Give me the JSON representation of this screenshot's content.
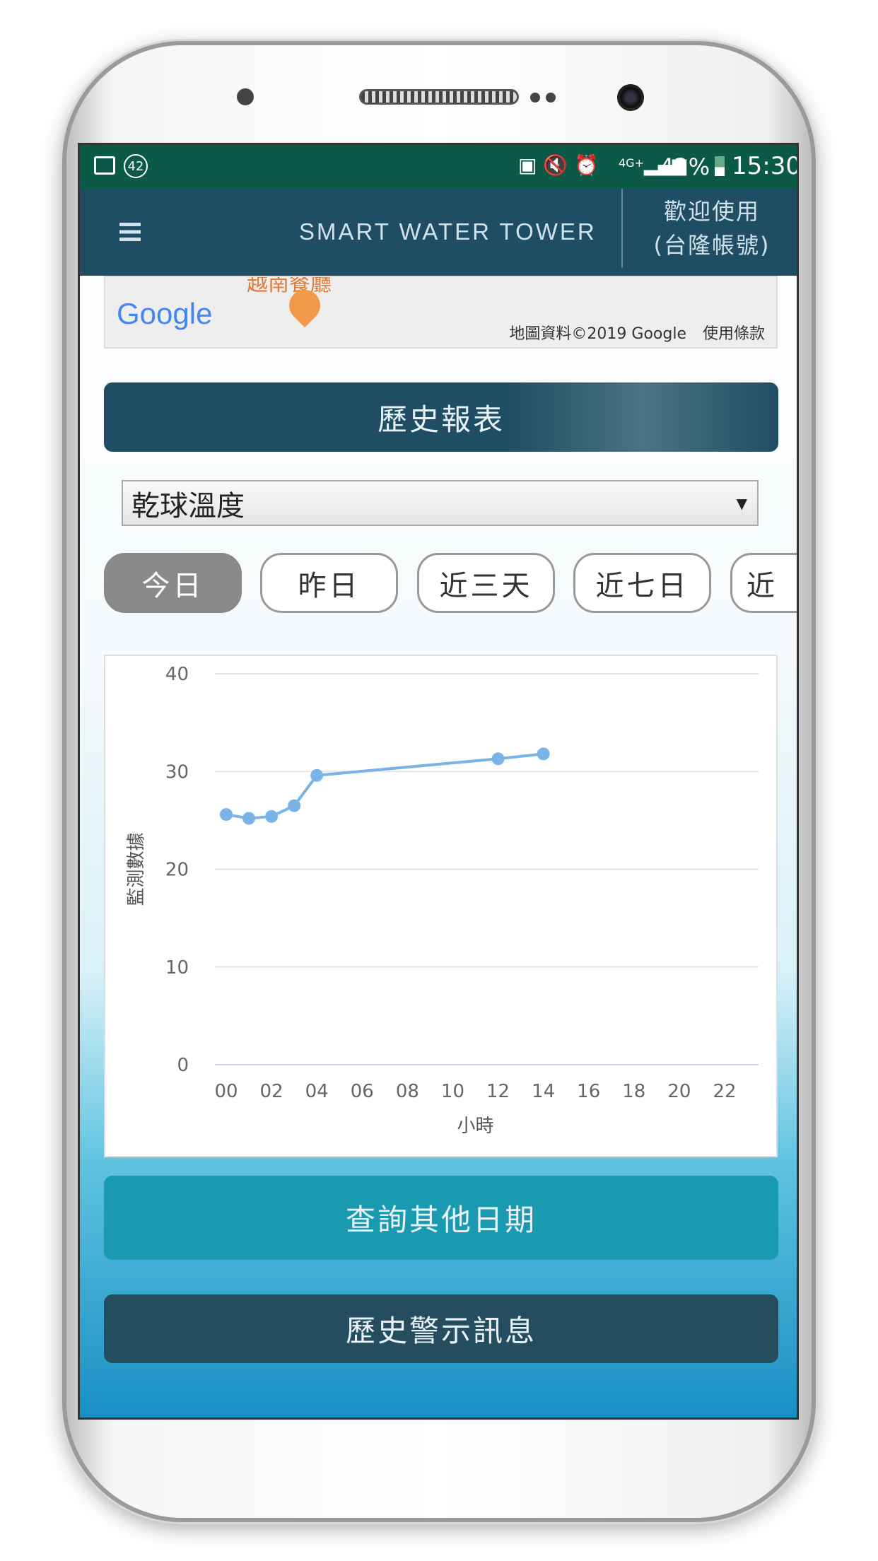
{
  "status_bar": {
    "notification_count": "42",
    "battery": "42%",
    "time": "15:30",
    "network": "4G+"
  },
  "header": {
    "menu_icon": "hamburger-icon",
    "title": "SMART WATER TOWER",
    "welcome": "歡迎使用",
    "account": "(台隆帳號)"
  },
  "map": {
    "logo": "Google",
    "attribution": "地圖資料©2019 Google",
    "terms": "使用條款",
    "poi_label": "越南餐廳"
  },
  "report_button": "歷史報表",
  "sensor_select": {
    "selected": "乾球溫度"
  },
  "range_tabs": [
    {
      "label": "今日",
      "active": true
    },
    {
      "label": "昨日"
    },
    {
      "label": "近三天"
    },
    {
      "label": "近七日"
    },
    {
      "label": "近"
    }
  ],
  "chart_data": {
    "type": "line",
    "xlabel": "小時",
    "ylabel": "監測數據",
    "x_ticks": [
      "00",
      "02",
      "04",
      "06",
      "08",
      "10",
      "12",
      "14",
      "16",
      "18",
      "20",
      "22"
    ],
    "y_ticks": [
      0,
      10,
      20,
      30,
      40
    ],
    "xlim": [
      0,
      22
    ],
    "ylim": [
      0,
      40
    ],
    "grid": true,
    "color": "#7ab4e6",
    "x": [
      0,
      1,
      2,
      3,
      4,
      12,
      14
    ],
    "y": [
      25.6,
      25.2,
      25.4,
      26.5,
      29.6,
      31.3,
      31.8
    ]
  },
  "query_button": "查詢其他日期",
  "alert_button": "歷史警示訊息",
  "colors": {
    "status_bar": "#0b5a48",
    "header": "#1f4d63",
    "query_button": "#1a9ab0",
    "alert_button": "#254d60"
  }
}
